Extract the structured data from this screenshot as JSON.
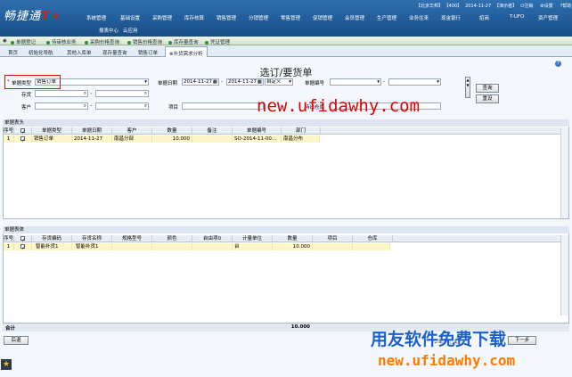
{
  "app": {
    "logo": "畅捷通",
    "logo_mark": "T+",
    "nav": [
      "系统管理",
      "基础设置",
      "采购管理",
      "库存核算",
      "销售管理",
      "分销管理",
      "零售管理",
      "促销管理",
      "会员管理",
      "生产管理",
      "业务往来",
      "现金银行",
      "招商",
      "T-UFO",
      "资产管理"
    ],
    "nav_row2": [
      "报表中心",
      "云应用"
    ],
    "user": {
      "company": "【北京华邦】",
      "account": "【400】",
      "date": "2014-11-27",
      "user": "【演示者】",
      "logout": "注销",
      "settings": "设置",
      "help": "帮助"
    }
  },
  "subnav": [
    "单据登记",
    "待审核业务",
    "采购价格查询",
    "销售价格查询",
    "库存量查询",
    "凭证管理"
  ],
  "tabs": [
    "首页",
    "初始化导航",
    "其他入库单",
    "现存量查询",
    "销售订单",
    "补货需求分析"
  ],
  "dialog": {
    "title": "选订/要货单",
    "help": "?",
    "filters": {
      "doc_type_label": "单据类型",
      "doc_type_value": "销售订单",
      "doc_date_label": "单据日期",
      "date_from": "2014-11-27",
      "date_to": "2014-11-27",
      "date_mode": "自定义",
      "doc_no_label": "单据编号",
      "dash": "-",
      "inventory_label": "存货",
      "customer_label": "客户",
      "project_label": "项目",
      "out_wh_label": "待出仓库"
    },
    "buttons": {
      "query": "查询",
      "reset": "重设",
      "back": "后退"
    }
  },
  "header_grid": {
    "section": "单据表头",
    "columns": [
      "序号",
      "",
      "单据类型",
      "单据日期",
      "客户",
      "数量",
      "备注",
      "单据编号",
      "部门"
    ],
    "rows": [
      [
        "1",
        "",
        "销售订单",
        "2014-11-27",
        "南昌分部",
        "10.000",
        "",
        "SO-2014-11-00...",
        "南昌分布"
      ]
    ]
  },
  "body_grid": {
    "section": "单据表体",
    "columns": [
      "序号",
      "",
      "存货编码",
      "存货名称",
      "规格型号",
      "颜色",
      "自由项0",
      "计量单位",
      "数量",
      "项目",
      "仓库"
    ],
    "rows": [
      [
        "1",
        "",
        "智能补货1",
        "智能补货1",
        "",
        "",
        "",
        "台",
        "10.000",
        "",
        ""
      ]
    ],
    "total_label": "合计",
    "total_qty": "10.000"
  },
  "footer": {
    "back_button": "后退",
    "hint_text": "本单据生成",
    "next_button": "下一步"
  },
  "watermarks": {
    "mid": "new.ufidawhy.com",
    "brand_cn": "用友软件免费下载",
    "brand_url": "new.ufidawhy.com"
  },
  "colors": {
    "topbar": "#1f5a98",
    "accent_red": "#e01010",
    "row_highlight": "#fdf6c8",
    "watermark_orange": "#ff7a00"
  }
}
